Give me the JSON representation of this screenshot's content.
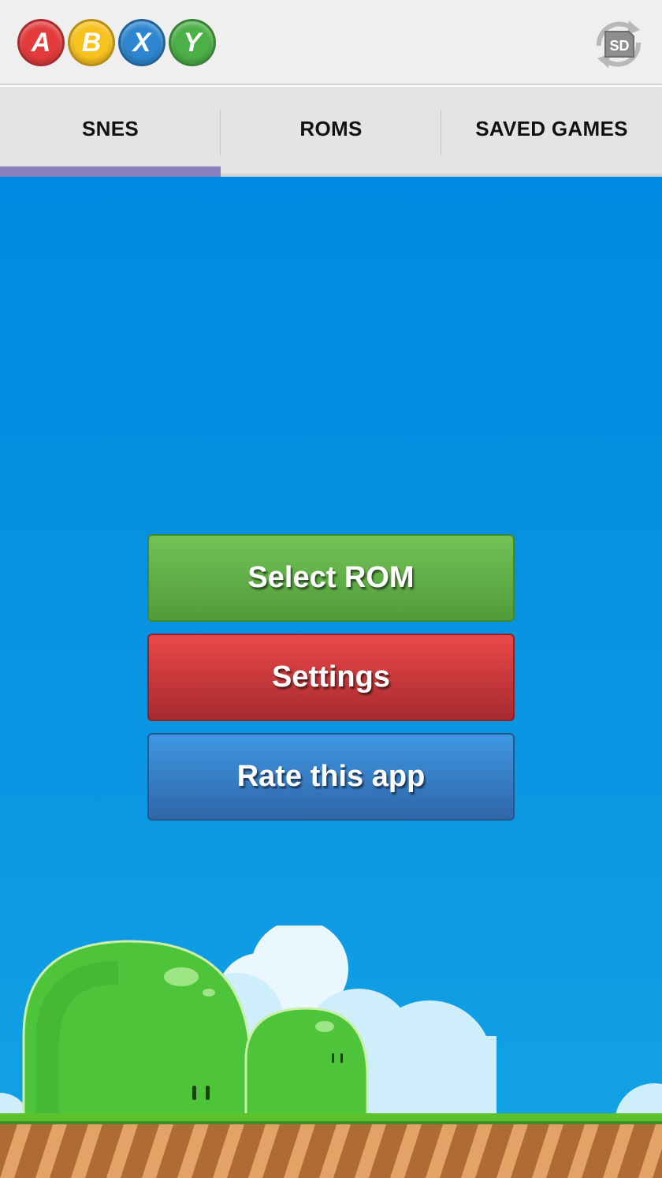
{
  "actionbar": {
    "logo_letters": [
      {
        "letter": "A",
        "color": "#e33b3c"
      },
      {
        "letter": "B",
        "color": "#f7c11e"
      },
      {
        "letter": "X",
        "color": "#2d86cf"
      },
      {
        "letter": "Y",
        "color": "#4caf47"
      }
    ],
    "sd_icon_text": "SD",
    "icon": "sd-card-sync-icon"
  },
  "tabs": [
    {
      "label": "SNES",
      "selected": true
    },
    {
      "label": "ROMS",
      "selected": false
    },
    {
      "label": "SAVED GAMES",
      "selected": false
    }
  ],
  "colors": {
    "tab_indicator": "#8a7ebf",
    "sky": "#0089e0",
    "select_rom": "#5aac40",
    "settings": "#d23a3d",
    "rate": "#3a7fc8"
  },
  "menu": {
    "select_rom": "Select ROM",
    "settings": "Settings",
    "rate": "Rate this app"
  }
}
